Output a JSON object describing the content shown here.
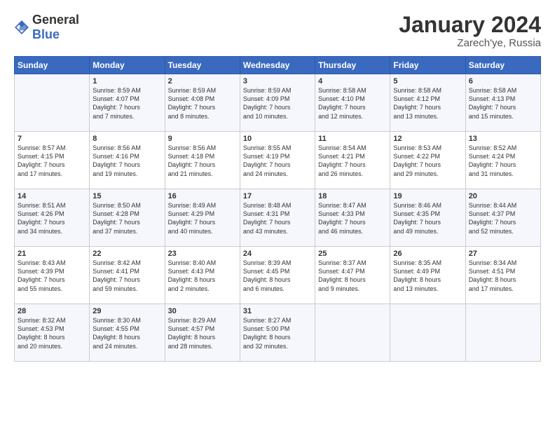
{
  "header": {
    "logo_general": "General",
    "logo_blue": "Blue",
    "month": "January 2024",
    "location": "Zarech'ye, Russia"
  },
  "days_of_week": [
    "Sunday",
    "Monday",
    "Tuesday",
    "Wednesday",
    "Thursday",
    "Friday",
    "Saturday"
  ],
  "weeks": [
    [
      {
        "day": "",
        "content": ""
      },
      {
        "day": "1",
        "content": "Sunrise: 8:59 AM\nSunset: 4:07 PM\nDaylight: 7 hours\nand 7 minutes."
      },
      {
        "day": "2",
        "content": "Sunrise: 8:59 AM\nSunset: 4:08 PM\nDaylight: 7 hours\nand 8 minutes."
      },
      {
        "day": "3",
        "content": "Sunrise: 8:59 AM\nSunset: 4:09 PM\nDaylight: 7 hours\nand 10 minutes."
      },
      {
        "day": "4",
        "content": "Sunrise: 8:58 AM\nSunset: 4:10 PM\nDaylight: 7 hours\nand 12 minutes."
      },
      {
        "day": "5",
        "content": "Sunrise: 8:58 AM\nSunset: 4:12 PM\nDaylight: 7 hours\nand 13 minutes."
      },
      {
        "day": "6",
        "content": "Sunrise: 8:58 AM\nSunset: 4:13 PM\nDaylight: 7 hours\nand 15 minutes."
      }
    ],
    [
      {
        "day": "7",
        "content": "Sunrise: 8:57 AM\nSunset: 4:15 PM\nDaylight: 7 hours\nand 17 minutes."
      },
      {
        "day": "8",
        "content": "Sunrise: 8:56 AM\nSunset: 4:16 PM\nDaylight: 7 hours\nand 19 minutes."
      },
      {
        "day": "9",
        "content": "Sunrise: 8:56 AM\nSunset: 4:18 PM\nDaylight: 7 hours\nand 21 minutes."
      },
      {
        "day": "10",
        "content": "Sunrise: 8:55 AM\nSunset: 4:19 PM\nDaylight: 7 hours\nand 24 minutes."
      },
      {
        "day": "11",
        "content": "Sunrise: 8:54 AM\nSunset: 4:21 PM\nDaylight: 7 hours\nand 26 minutes."
      },
      {
        "day": "12",
        "content": "Sunrise: 8:53 AM\nSunset: 4:22 PM\nDaylight: 7 hours\nand 29 minutes."
      },
      {
        "day": "13",
        "content": "Sunrise: 8:52 AM\nSunset: 4:24 PM\nDaylight: 7 hours\nand 31 minutes."
      }
    ],
    [
      {
        "day": "14",
        "content": "Sunrise: 8:51 AM\nSunset: 4:26 PM\nDaylight: 7 hours\nand 34 minutes."
      },
      {
        "day": "15",
        "content": "Sunrise: 8:50 AM\nSunset: 4:28 PM\nDaylight: 7 hours\nand 37 minutes."
      },
      {
        "day": "16",
        "content": "Sunrise: 8:49 AM\nSunset: 4:29 PM\nDaylight: 7 hours\nand 40 minutes."
      },
      {
        "day": "17",
        "content": "Sunrise: 8:48 AM\nSunset: 4:31 PM\nDaylight: 7 hours\nand 43 minutes."
      },
      {
        "day": "18",
        "content": "Sunrise: 8:47 AM\nSunset: 4:33 PM\nDaylight: 7 hours\nand 46 minutes."
      },
      {
        "day": "19",
        "content": "Sunrise: 8:46 AM\nSunset: 4:35 PM\nDaylight: 7 hours\nand 49 minutes."
      },
      {
        "day": "20",
        "content": "Sunrise: 8:44 AM\nSunset: 4:37 PM\nDaylight: 7 hours\nand 52 minutes."
      }
    ],
    [
      {
        "day": "21",
        "content": "Sunrise: 8:43 AM\nSunset: 4:39 PM\nDaylight: 7 hours\nand 55 minutes."
      },
      {
        "day": "22",
        "content": "Sunrise: 8:42 AM\nSunset: 4:41 PM\nDaylight: 7 hours\nand 59 minutes."
      },
      {
        "day": "23",
        "content": "Sunrise: 8:40 AM\nSunset: 4:43 PM\nDaylight: 8 hours\nand 2 minutes."
      },
      {
        "day": "24",
        "content": "Sunrise: 8:39 AM\nSunset: 4:45 PM\nDaylight: 8 hours\nand 6 minutes."
      },
      {
        "day": "25",
        "content": "Sunrise: 8:37 AM\nSunset: 4:47 PM\nDaylight: 8 hours\nand 9 minutes."
      },
      {
        "day": "26",
        "content": "Sunrise: 8:35 AM\nSunset: 4:49 PM\nDaylight: 8 hours\nand 13 minutes."
      },
      {
        "day": "27",
        "content": "Sunrise: 8:34 AM\nSunset: 4:51 PM\nDaylight: 8 hours\nand 17 minutes."
      }
    ],
    [
      {
        "day": "28",
        "content": "Sunrise: 8:32 AM\nSunset: 4:53 PM\nDaylight: 8 hours\nand 20 minutes."
      },
      {
        "day": "29",
        "content": "Sunrise: 8:30 AM\nSunset: 4:55 PM\nDaylight: 8 hours\nand 24 minutes."
      },
      {
        "day": "30",
        "content": "Sunrise: 8:29 AM\nSunset: 4:57 PM\nDaylight: 8 hours\nand 28 minutes."
      },
      {
        "day": "31",
        "content": "Sunrise: 8:27 AM\nSunset: 5:00 PM\nDaylight: 8 hours\nand 32 minutes."
      },
      {
        "day": "",
        "content": ""
      },
      {
        "day": "",
        "content": ""
      },
      {
        "day": "",
        "content": ""
      }
    ]
  ]
}
